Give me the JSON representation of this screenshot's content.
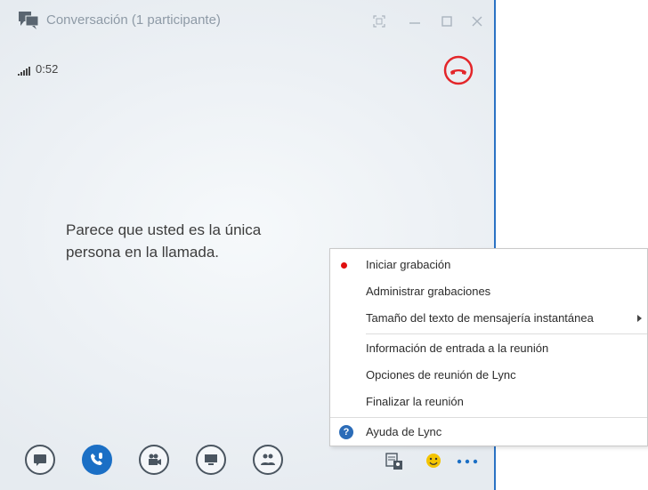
{
  "window": {
    "title": "Conversación (1 participante)",
    "call_timer": "0:52",
    "message": "Parece que usted es la única persona en la llamada."
  },
  "colors": {
    "accent": "#1b6fc5",
    "hangup": "#e3262a",
    "record_dot": "#e00f0f"
  },
  "icons": {
    "title": "conversation-icon",
    "hangup": "hang-up-icon",
    "signal": "signal-strength-icon"
  },
  "controls": [
    {
      "name": "im-button",
      "icon": "chat-bubble-icon",
      "active": false
    },
    {
      "name": "audio-button",
      "icon": "phone-mic-icon",
      "active": true
    },
    {
      "name": "video-button",
      "icon": "video-camera-icon",
      "active": false
    },
    {
      "name": "present-button",
      "icon": "monitor-icon",
      "active": false
    },
    {
      "name": "participants-button",
      "icon": "people-icon",
      "active": false
    }
  ],
  "menu": {
    "items": [
      {
        "label": "Iniciar grabación"
      },
      {
        "label": "Administrar grabaciones"
      },
      {
        "label": "Tamaño del texto de mensajería instantánea"
      },
      {
        "label": "Información de entrada a la reunión"
      },
      {
        "label": "Opciones de reunión de Lync"
      },
      {
        "label": "Finalizar la reunión"
      },
      {
        "label": "Ayuda de Lync"
      }
    ]
  }
}
